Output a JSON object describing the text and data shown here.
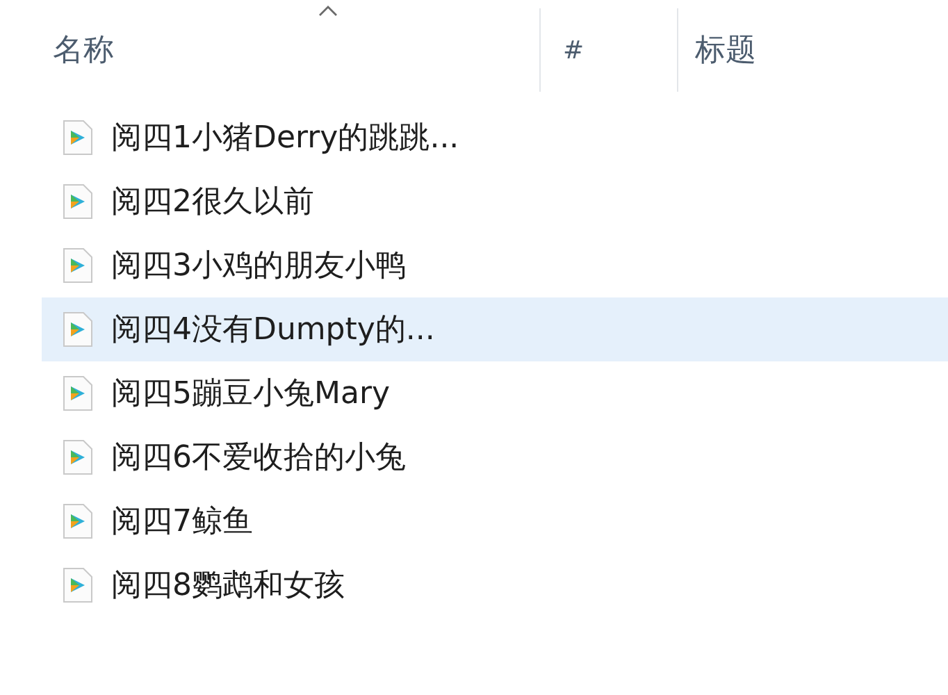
{
  "columns": [
    {
      "label": "名称",
      "sorted": true
    },
    {
      "label": "#",
      "sorted": false
    },
    {
      "label": "标题",
      "sorted": false
    }
  ],
  "files": [
    {
      "name": "阅四1小猪Derry的跳跳...",
      "selected": false
    },
    {
      "name": "阅四2很久以前",
      "selected": false
    },
    {
      "name": "阅四3小鸡的朋友小鸭",
      "selected": false
    },
    {
      "name": "阅四4没有Dumpty的...",
      "selected": true
    },
    {
      "name": "阅四5蹦豆小兔Mary",
      "selected": false
    },
    {
      "name": "阅四6不爱收拾的小兔",
      "selected": false
    },
    {
      "name": "阅四7鲸鱼",
      "selected": false
    },
    {
      "name": "阅四8鹦鹉和女孩",
      "selected": false
    }
  ]
}
